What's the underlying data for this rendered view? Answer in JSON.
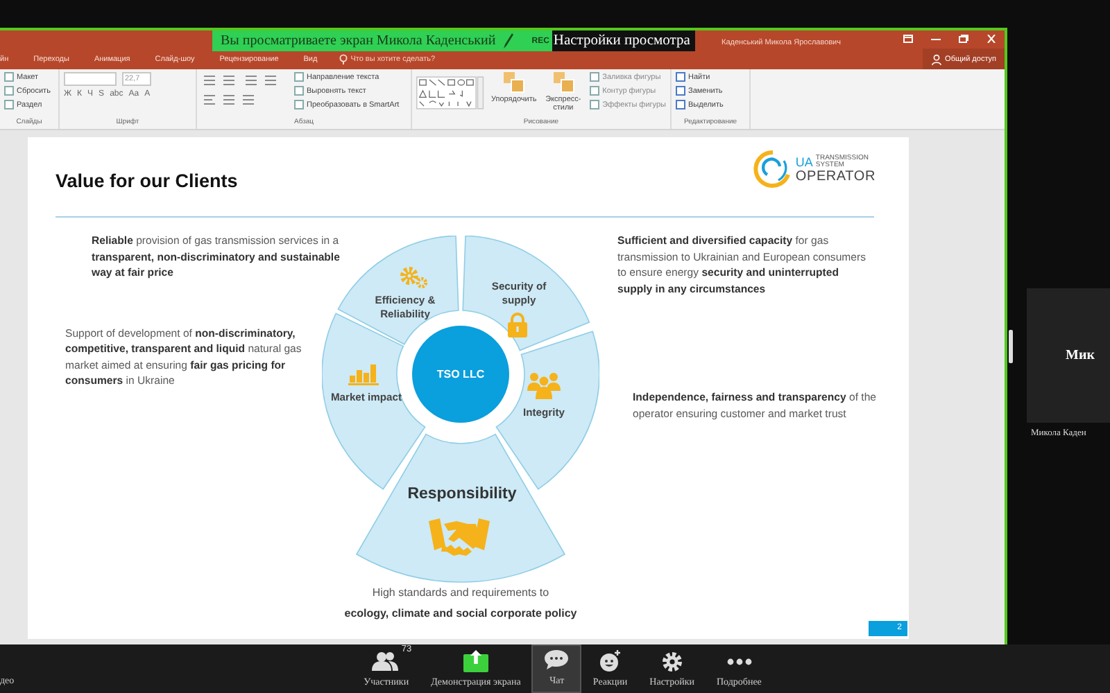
{
  "viewer_banner": {
    "text": "Вы просматриваете экран Микола Каденський",
    "rec": "REC",
    "options": "Настройки просмотра"
  },
  "powerpoint": {
    "user": "Каденський Микола Ярославович",
    "share": "Общий доступ",
    "tabs": [
      "йн",
      "Переходы",
      "Анимация",
      "Слайд-шоу",
      "Рецензирование",
      "Вид"
    ],
    "tell_me": "Что вы хотите сделать?",
    "ribbon": [
      {
        "kind": "slides",
        "label": "Слайды",
        "items": [
          "Макет",
          "Сбросить",
          "Раздел"
        ]
      },
      {
        "kind": "font",
        "label": "Шрифт",
        "font_size": "22,7",
        "format_buttons": [
          "Ж",
          "К",
          "Ч",
          "S",
          "abc",
          "Aa",
          "A"
        ]
      },
      {
        "kind": "paragraph",
        "label": "Абзац",
        "items": [
          "Направление текста",
          "Выровнять текст",
          "Преобразовать в SmartArt"
        ]
      },
      {
        "kind": "drawing",
        "label": "Рисование",
        "buttons": [
          "Упорядочить",
          "Экспресс-стили"
        ],
        "items": [
          "Заливка фигуры",
          "Контур фигуры",
          "Эффекты фигуры"
        ]
      },
      {
        "kind": "editing",
        "label": "Редактирование",
        "items": [
          "Найти",
          "Заменить",
          "Выделить"
        ]
      }
    ]
  },
  "slide": {
    "title": "Value for our Clients",
    "logo": {
      "short": "UA",
      "tagline": "TRANSMISSION SYSTEM",
      "name": "OPERATOR"
    },
    "left_texts": [
      "**Reliable** provision of gas transmission services in a **transparent, non-discriminatory and sustainable way at fair price**",
      "Support of development of **non-discriminatory, competitive, transparent and liquid** natural gas market aimed at ensuring **fair gas pricing for consumers** in Ukraine"
    ],
    "center": "TSO LLC",
    "segments": [
      {
        "label": "Efficiency & Reliability"
      },
      {
        "label": "Security of supply"
      },
      {
        "label": "Integrity"
      },
      {
        "label": "Responsibility"
      },
      {
        "label": "Market impact"
      }
    ],
    "caption": [
      {
        "text": "High standards and requirements to",
        "bold": false
      },
      {
        "text": "ecology, climate and social corporate policy",
        "bold": true
      }
    ],
    "right_texts": [
      "**Sufficient and diversified capacity** for gas transmission to Ukrainian and European consumers  to ensure energy **security and uninterrupted supply in any circumstances**",
      "**Independence, fairness and transparency** of the operator ensuring customer and market trust"
    ],
    "page_number": "2"
  },
  "participant": {
    "tile_text": "Мик",
    "name": "Микола Каден"
  },
  "toolbar": {
    "left_cut": "део",
    "items": [
      {
        "label": "Участники",
        "count": "73",
        "selected": false
      },
      {
        "label": "Демонстрация экрана",
        "selected": false
      },
      {
        "label": "Чат",
        "selected": true
      },
      {
        "label": "Реакции",
        "selected": false
      },
      {
        "label": "Настройки",
        "selected": false
      },
      {
        "label": "Подробнее",
        "selected": false
      }
    ]
  }
}
